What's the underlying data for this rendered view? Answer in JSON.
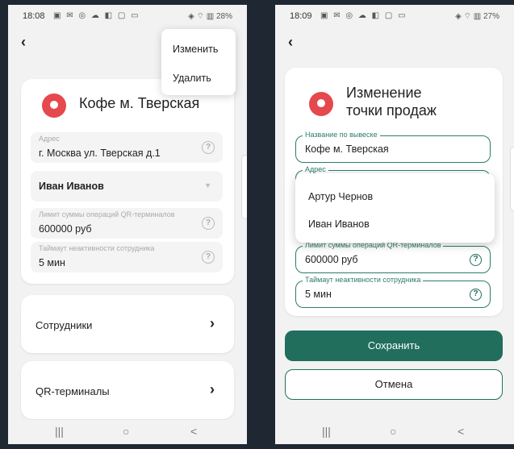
{
  "left": {
    "status": {
      "time": "18:08",
      "icons": "▣ ✉ ◎ ☁ ◧ ▢ ▭",
      "right": "◈ ⌔ ▥ 28%"
    },
    "menu": {
      "edit": "Изменить",
      "delete": "Удалить"
    },
    "header_title": "Кофе м. Тверская",
    "address": {
      "label": "Адрес",
      "value": "г. Москва ул. Тверская д.1"
    },
    "employee_select": "Иван Иванов",
    "limit": {
      "label": "Лимит суммы операций QR-терминалов",
      "value": "600000 руб"
    },
    "timeout": {
      "label": "Таймаут неактивности сотрудника",
      "value": "5 мин"
    },
    "nav": {
      "employees": "Сотрудники",
      "qr_terminals": "QR-терминалы"
    }
  },
  "right": {
    "status": {
      "time": "18:09",
      "icons": "▣ ✉ ◎ ☁ ◧ ▢ ▭",
      "right": "◈ ⌔ ▥ 27%"
    },
    "title_line1": "Изменение",
    "title_line2": "точки продаж",
    "name": {
      "label": "Название по вывеске",
      "value": "Кофе м. Тверская"
    },
    "address_label": "Адрес",
    "dropdown": [
      "Артур Чернов",
      "Иван Иванов"
    ],
    "limit": {
      "label": "Лимит суммы операций QR-терминалов",
      "value": "600000 руб"
    },
    "timeout": {
      "label": "Таймаут неактивности сотрудника",
      "value": "5 мин"
    },
    "save": "Сохранить",
    "cancel": "Отмена"
  },
  "nav_bar": {
    "recents": "|||",
    "home": "○",
    "back": "<"
  },
  "colors": {
    "accent": "#216e5d",
    "pin": "#e5484d"
  }
}
